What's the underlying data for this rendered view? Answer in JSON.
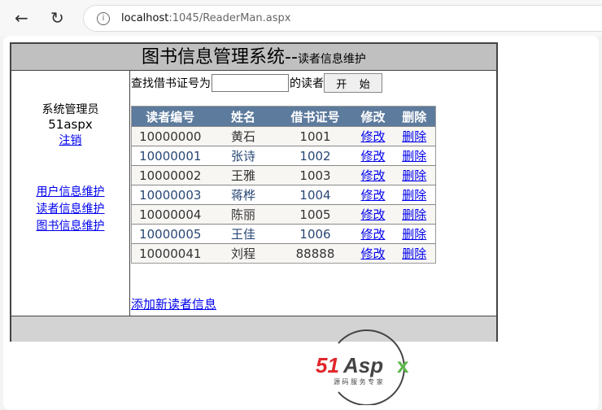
{
  "browser": {
    "url_host": "localhost",
    "url_path": ":1045/ReaderMan.aspx"
  },
  "header": {
    "title": "图书信息管理系统--",
    "subtitle": "读者信息维护"
  },
  "sidebar": {
    "role": "系统管理员",
    "username": "51aspx",
    "logout": "注销",
    "links": [
      "用户信息维护",
      "读者信息维护",
      "图书信息维护"
    ]
  },
  "search": {
    "prefix": "查找借书证号为",
    "value": "",
    "suffix": "的读者",
    "button": "开 始"
  },
  "table": {
    "headers": [
      "读者编号",
      "姓名",
      "借书证号",
      "修改",
      "删除"
    ],
    "rows": [
      [
        "10000000",
        "黄石",
        "1001",
        "修改",
        "删除"
      ],
      [
        "10000001",
        "张诗",
        "1002",
        "修改",
        "删除"
      ],
      [
        "10000002",
        "王雅",
        "1003",
        "修改",
        "删除"
      ],
      [
        "10000003",
        "蒋桦",
        "1004",
        "修改",
        "删除"
      ],
      [
        "10000004",
        "陈丽",
        "1005",
        "修改",
        "删除"
      ],
      [
        "10000005",
        "王佳",
        "1006",
        "修改",
        "删除"
      ],
      [
        "10000041",
        "刘程",
        "88888",
        "修改",
        "删除"
      ]
    ]
  },
  "add_link": "添加新读者信息",
  "watermark": {
    "brand": "51Aspx",
    "tagline": "源码服务专家"
  }
}
